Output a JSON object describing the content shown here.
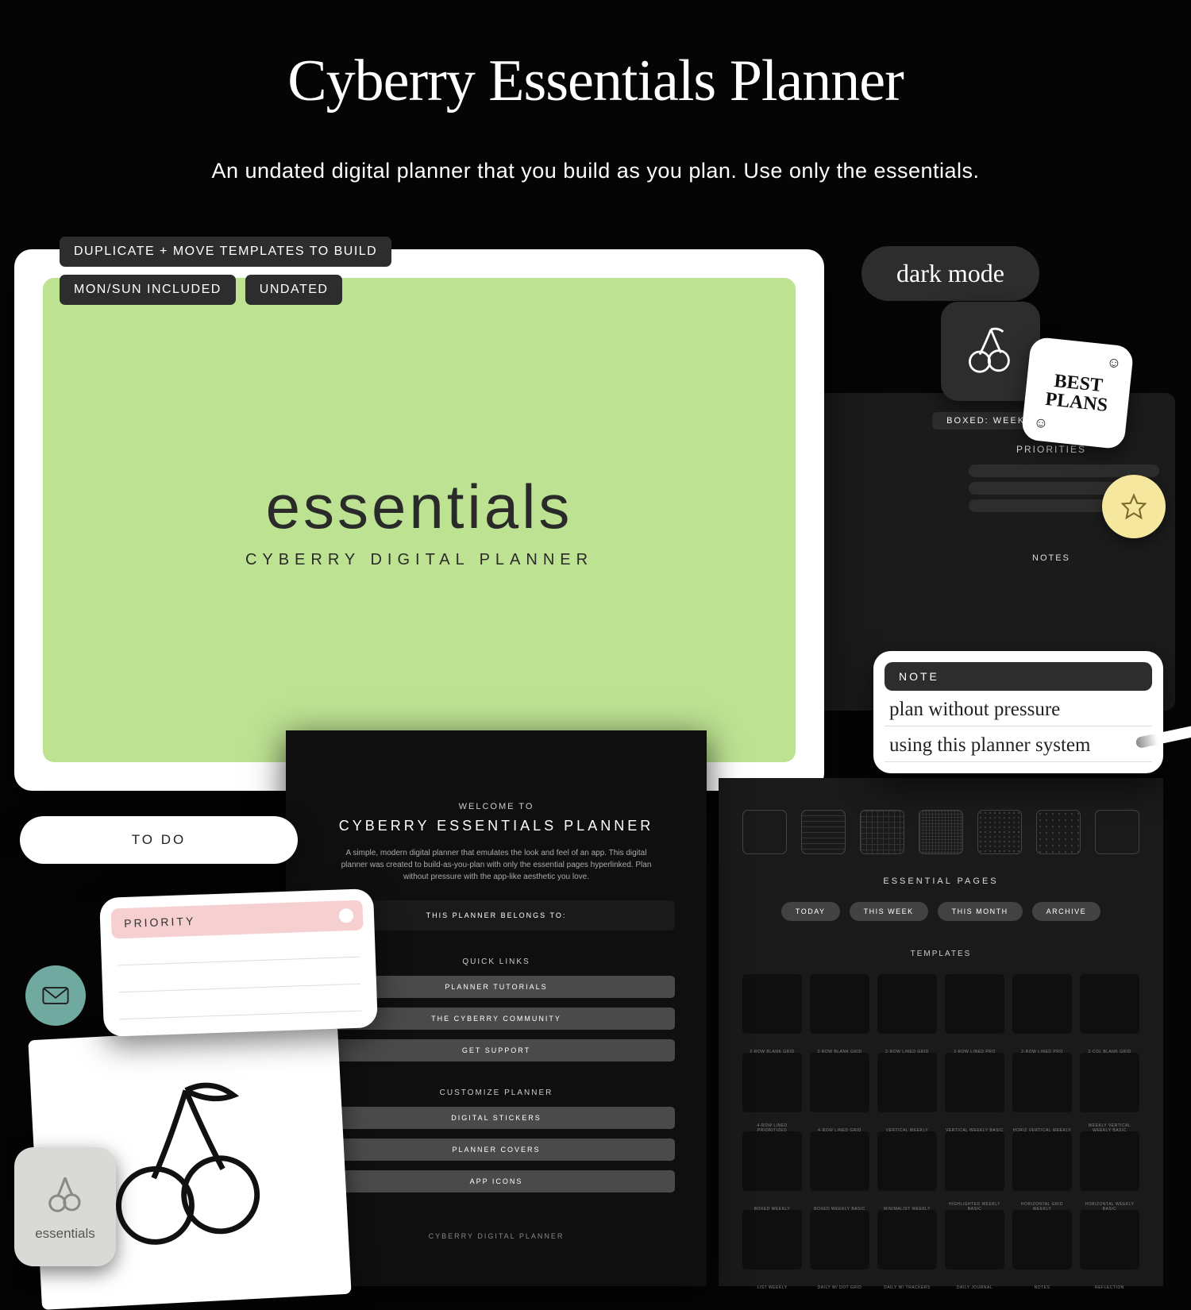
{
  "page": {
    "title": "Cyberry Essentials Planner",
    "subtitle": "An undated digital planner that you build as you plan. Use only the essentials."
  },
  "badges": {
    "duplicate": "DUPLICATE + MOVE TEMPLATES TO BUILD",
    "mon_sun": "MON/SUN INCLUDED",
    "undated": "UNDATED"
  },
  "cover": {
    "title": "essentials",
    "subtitle": "CYBERRY DIGITAL PLANNER"
  },
  "dark_mode_label": "dark mode",
  "best_plans": {
    "line1": "BEST",
    "line2": "PLANS"
  },
  "boxed_weekly": {
    "header": "BOXED: WEEKLY",
    "priorities_label": "PRIORITIES",
    "notes_label": "NOTES"
  },
  "note_card": {
    "header": "NOTE",
    "line1": "plan without pressure",
    "line2": "using this planner system"
  },
  "todo_label": "TO DO",
  "priority_card_label": "PRIORITY",
  "welcome": {
    "small": "WELCOME TO",
    "title": "CYBERRY ESSENTIALS PLANNER",
    "desc": "A simple, modern digital planner that emulates the look and feel of an app. This digital planner was created to build-as-you-plan with only the essential pages hyperlinked. Plan without pressure with the app-like aesthetic you love.",
    "belongs_to": "THIS PLANNER BELONGS TO:",
    "quick_links_label": "QUICK LINKS",
    "links": {
      "tutorials": "PLANNER TUTORIALS",
      "community": "THE CYBERRY COMMUNITY",
      "support": "GET SUPPORT"
    },
    "customize_label": "CUSTOMIZE PLANNER",
    "customize": {
      "stickers": "DIGITAL STICKERS",
      "covers": "PLANNER COVERS",
      "icons": "APP ICONS"
    },
    "footer": "CYBERRY DIGITAL PLANNER"
  },
  "templates_panel": {
    "essential_pages_label": "ESSENTIAL PAGES",
    "pills": {
      "today": "TODAY",
      "week": "THIS WEEK",
      "month": "THIS MONTH",
      "archive": "ARCHIVE"
    },
    "templates_label": "TEMPLATES",
    "items": [
      "2-ROW BLANK GRID",
      "2-ROW BLANK GRID",
      "2-ROW LINED GRID",
      "2-ROW LINED PRO",
      "2-ROW LINED PRO",
      "2-COL BLANK GRID",
      "4-ROW LINED PRIORITIZED",
      "4-ROW LINED GRID",
      "VERTICAL WEEKLY",
      "VERTICAL WEEKLY BASIC",
      "HORIZ VERTICAL WEEKLY",
      "WEEKLY VERTICAL WEEKLY BASIC",
      "BOXED WEEKLY",
      "BOXED WEEKLY BASIC",
      "MINIMALIST WEEKLY",
      "HIGHLIGHTED WEEKLY BASIC",
      "HORIZONTAL GRID WEEKLY",
      "HORIZONTAL WEEKLY BASIC",
      "LIST WEEKLY",
      "DAILY W/ DOT GRID",
      "DAILY W/ TRACKERS",
      "DAILY JOURNAL",
      "NOTES",
      "REFLECTION"
    ]
  },
  "essentials_tile_label": "essentials"
}
